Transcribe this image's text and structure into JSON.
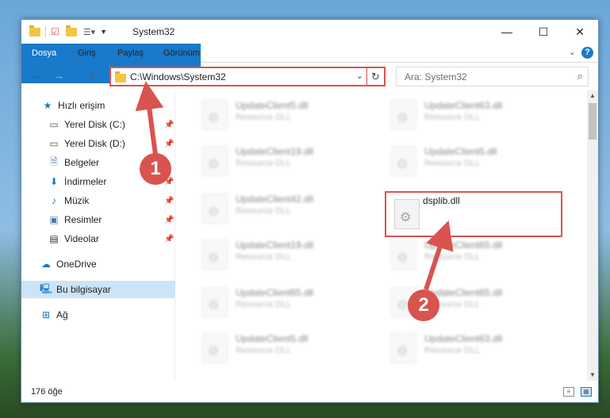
{
  "window": {
    "title": "System32",
    "controls": {
      "minimize": "—",
      "maximize": "☐",
      "close": "✕"
    }
  },
  "ribbon": {
    "tabs": [
      "Dosya",
      "Giriş",
      "Paylaş",
      "Görünüm"
    ],
    "help": "?"
  },
  "nav": {
    "address": "C:\\Windows\\System32",
    "search_placeholder": "Ara: System32"
  },
  "sidebar": {
    "items": [
      {
        "label": "Hızlı erişim",
        "icon": "star-icon",
        "pinned": false
      },
      {
        "label": "Yerel Disk (C:)",
        "icon": "drive-icon",
        "pinned": true
      },
      {
        "label": "Yerel Disk (D:)",
        "icon": "drive-icon",
        "pinned": true
      },
      {
        "label": "Belgeler",
        "icon": "documents-icon",
        "pinned": true
      },
      {
        "label": "İndirmeler",
        "icon": "download-icon",
        "pinned": true
      },
      {
        "label": "Müzik",
        "icon": "music-icon",
        "pinned": true
      },
      {
        "label": "Resimler",
        "icon": "pictures-icon",
        "pinned": true
      },
      {
        "label": "Videolar",
        "icon": "videos-icon",
        "pinned": true
      },
      {
        "label": "OneDrive",
        "icon": "cloud-icon",
        "pinned": false
      },
      {
        "label": "Bu bilgisayar",
        "icon": "computer-icon",
        "pinned": false
      },
      {
        "label": "Ağ",
        "icon": "network-icon",
        "pinned": false
      }
    ]
  },
  "files": {
    "left": [
      {
        "name": "UpdateClient5.dll",
        "type": "Resource DLL"
      },
      {
        "name": "UpdateClient19.dll",
        "type": "Resource DLL"
      },
      {
        "name": "UpdateClient42.dll",
        "type": "Resource DLL"
      },
      {
        "name": "UpdateClient19.dll",
        "type": "Resource DLL"
      },
      {
        "name": "UpdateClient65.dll",
        "type": "Resource DLL"
      },
      {
        "name": "UpdateClient5.dll",
        "type": "Resource DLL"
      }
    ],
    "right": [
      {
        "name": "UpdateClient63.dll",
        "type": "Resource DLL"
      },
      {
        "name": "UpdateClient5.dll",
        "type": "Resource DLL"
      },
      {
        "name": "dsplib.dll",
        "type": ""
      },
      {
        "name": "UpdateClient65.dll",
        "type": "Resource DLL"
      },
      {
        "name": "UpdateClient65.dll",
        "type": "Resource DLL"
      },
      {
        "name": "UpdateClient63.dll",
        "type": "Resource DLL"
      }
    ]
  },
  "status": {
    "count": "176 öğe"
  },
  "annotations": {
    "badge1": "1",
    "badge2": "2",
    "color": "#d9534f"
  }
}
